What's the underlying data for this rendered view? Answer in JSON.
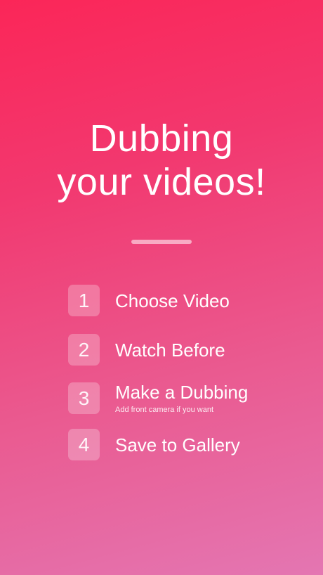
{
  "headline": {
    "line1": "Dubbing",
    "line2": "your videos!"
  },
  "steps": [
    {
      "number": "1",
      "label": "Choose Video"
    },
    {
      "number": "2",
      "label": "Watch Before"
    },
    {
      "number": "3",
      "label": "Make a Dubbing",
      "hint": "Add front camera if you want"
    },
    {
      "number": "4",
      "label": "Save to Gallery"
    }
  ],
  "colors": {
    "gradient_top": "#fb2658",
    "gradient_bottom": "#e476b2",
    "text": "#ffffff"
  }
}
